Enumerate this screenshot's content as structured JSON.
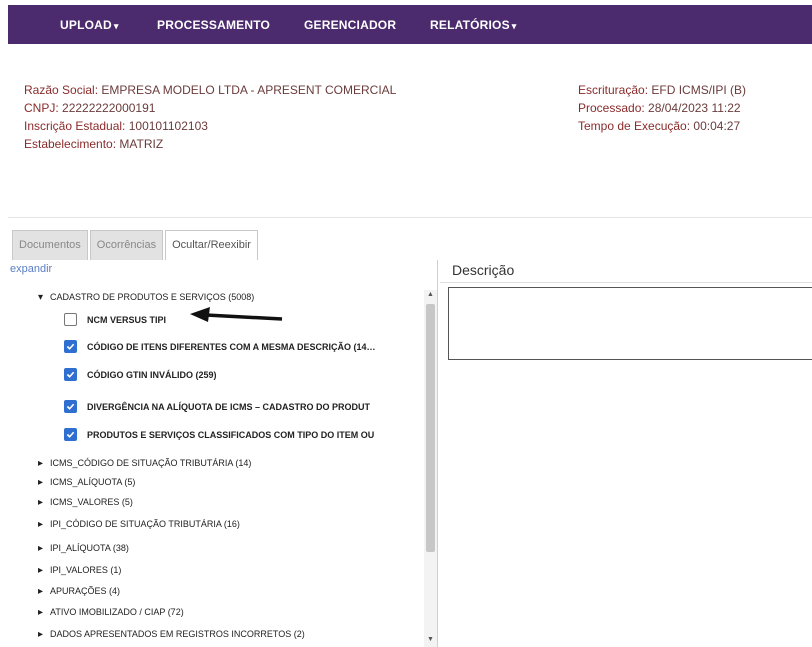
{
  "nav": {
    "items": [
      {
        "label": "UPLOAD",
        "caret": "▾"
      },
      {
        "label": "PROCESSAMENTO",
        "caret": ""
      },
      {
        "label": "GERENCIADOR",
        "caret": ""
      },
      {
        "label": "RELATÓRIOS",
        "caret": "▾"
      }
    ]
  },
  "company": {
    "razao_label": "Razão Social:",
    "razao_value": "EMPRESA MODELO LTDA - APRESENT COMERCIAL",
    "cnpj_label": "CNPJ:",
    "cnpj_value": "22222222000191",
    "ie_label": "Inscrição Estadual:",
    "ie_value": "100101102103",
    "estab_label": "Estabelecimento:",
    "estab_value": "MATRIZ"
  },
  "process": {
    "escrit_label": "Escrituração:",
    "escrit_value": "EFD ICMS/IPI (B)",
    "proc_label": "Processado:",
    "proc_value": "28/04/2023 11:22",
    "tempo_label": "Tempo de Execução:",
    "tempo_value": "00:04:27"
  },
  "tabs": [
    {
      "label": "Documentos",
      "active": false
    },
    {
      "label": "Ocorrências",
      "active": false
    },
    {
      "label": "Ocultar/Reexibir",
      "active": true
    }
  ],
  "tree": {
    "expand_label": "expandir",
    "open_group": {
      "label": "CADASTRO DE PRODUTOS E SERVIÇOS (5008)",
      "children": [
        {
          "label": "NCM VERSUS TIPI",
          "checked": false
        },
        {
          "label": "CÓDIGO DE ITENS DIFERENTES COM A MESMA DESCRIÇÃO (14…",
          "checked": true
        },
        {
          "label": "CÓDIGO GTIN INVÁLIDO (259)",
          "checked": true
        },
        {
          "label": "DIVERGÊNCIA NA ALÍQUOTA DE ICMS – CADASTRO DO PRODUT",
          "checked": true
        },
        {
          "label": "PRODUTOS E SERVIÇOS CLASSIFICADOS COM TIPO DO ITEM OU",
          "checked": true
        }
      ]
    },
    "groups": [
      "ICMS_CÓDIGO DE SITUAÇÃO TRIBUTÁRIA (14)",
      "ICMS_ALÍQUOTA (5)",
      "ICMS_VALORES (5)",
      "IPI_CÓDIGO DE SITUAÇÃO TRIBUTÁRIA (16)",
      "IPI_ALÍQUOTA (38)",
      "IPI_VALORES (1)",
      "APURAÇÕES (4)",
      "ATIVO IMOBILIZADO / CIAP (72)",
      "DADOS APRESENTADOS EM REGISTROS INCORRETOS (2)"
    ]
  },
  "description": {
    "title": "Descrição",
    "content": ""
  },
  "colors": {
    "nav_bg": "#4b2a6e",
    "label_red": "#8a2b2b",
    "checkbox_blue": "#2f6fd0",
    "link_blue": "#5b7fc5"
  }
}
